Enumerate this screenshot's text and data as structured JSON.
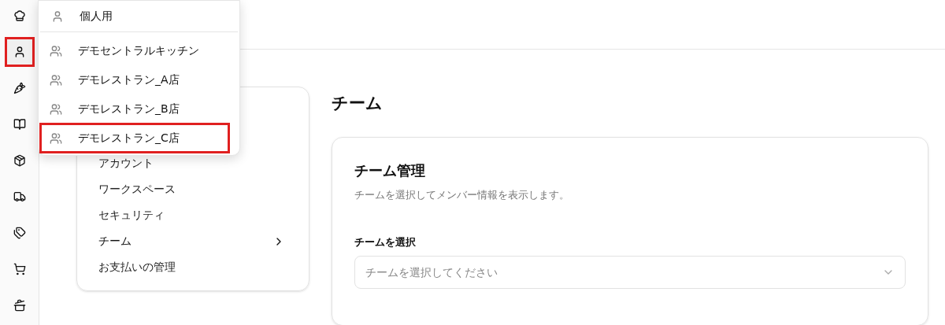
{
  "sidebar": {
    "items": [
      {
        "kind": "chef",
        "highlighted": false
      },
      {
        "kind": "user",
        "highlighted": true
      },
      {
        "kind": "carrot",
        "highlighted": false
      },
      {
        "kind": "book",
        "highlighted": false
      },
      {
        "kind": "box",
        "highlighted": false
      },
      {
        "kind": "truck",
        "highlighted": false
      },
      {
        "kind": "tags",
        "highlighted": false
      },
      {
        "kind": "cart",
        "highlighted": false
      },
      {
        "kind": "pot",
        "highlighted": false
      }
    ]
  },
  "workspace_menu": {
    "personal": {
      "label": "個人用"
    },
    "teams": [
      {
        "label": "デモセントラルキッチン",
        "highlighted": false
      },
      {
        "label": "デモレストラン_A店",
        "highlighted": false
      },
      {
        "label": "デモレストラン_B店",
        "highlighted": false
      },
      {
        "label": "デモレストラン_C店",
        "highlighted": true
      }
    ]
  },
  "settings_nav": {
    "items": [
      {
        "label": "アカウント",
        "selected": false
      },
      {
        "label": "ワークスペース",
        "selected": false
      },
      {
        "label": "セキュリティ",
        "selected": false
      },
      {
        "label": "チーム",
        "selected": true
      },
      {
        "label": "お支払いの管理",
        "selected": false
      }
    ]
  },
  "page_title": "チーム",
  "card": {
    "title": "チーム管理",
    "description": "チームを選択してメンバー情報を表示します。",
    "field_label": "チームを選択",
    "select_placeholder": "チームを選択してください"
  }
}
